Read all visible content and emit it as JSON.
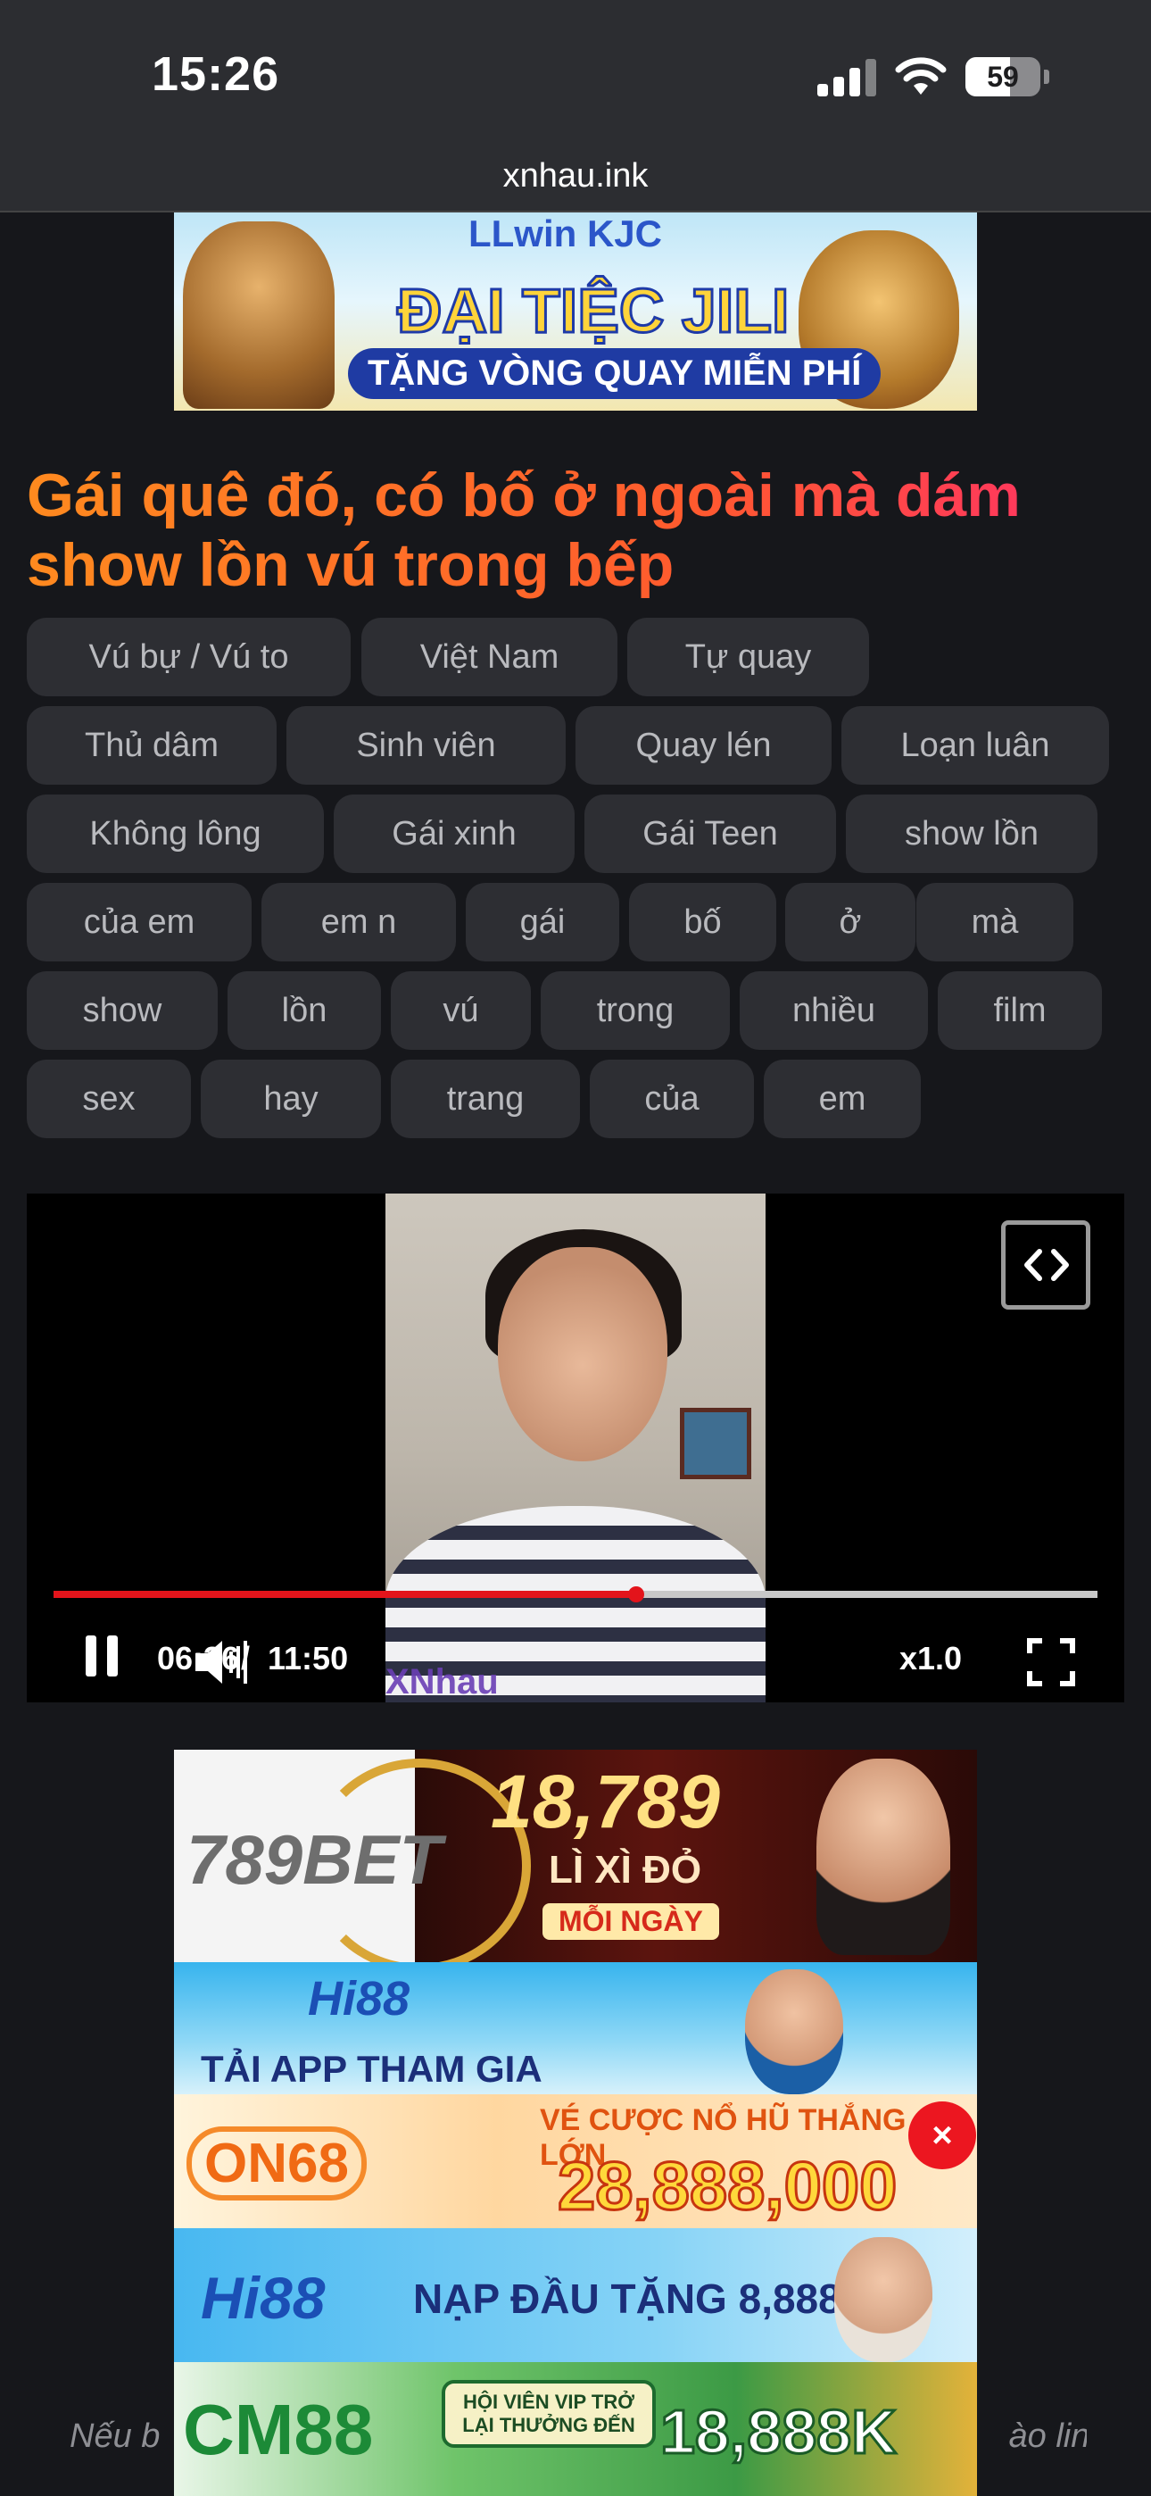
{
  "status_bar": {
    "time": "15:26",
    "battery": "59",
    "battery_level": 0.59
  },
  "browser": {
    "url": "xnhau.ink"
  },
  "top_ad": {
    "brand": "LLwin KJC",
    "headline": "ĐẠI TIỆC JILI",
    "sub": "TẶNG VÒNG QUAY MIỄN PHÍ"
  },
  "page": {
    "title": "Gái quê đó, có bố ở ngoài mà dám show lồn vú trong bếp",
    "tags": [
      "Vú bự / Vú to",
      "Việt Nam",
      "Tự quay",
      "Thủ dâm",
      "Sinh viên",
      "Quay lén",
      "Loạn luân",
      "Không lông",
      "Gái xinh",
      "Gái Teen",
      "show lồn",
      "của em",
      "em n",
      "gái",
      "bố",
      "ở",
      "mà",
      "show",
      "lồn",
      "vú",
      "trong",
      "nhiều",
      "film",
      "sex",
      "hay",
      "trang",
      "của",
      "em"
    ]
  },
  "player": {
    "current_time": "06:36",
    "separator": "/",
    "duration": "11:50",
    "speed": "x1.0",
    "progress": 0.558,
    "watermark": "XNhau",
    "colors": {
      "played": "#e3141b",
      "track": "#c8c8c8"
    }
  },
  "ads": {
    "ad1": {
      "logo": "789BET",
      "amount": "18,789",
      "line": "LÌ XÌ ĐỎ",
      "pill": "MỖI NGÀY"
    },
    "ad2": {
      "logo": "Hi88",
      "text": "TẢI APP THAM GIA"
    },
    "ad3": {
      "logo": "ON68",
      "line": "VÉ CƯỢC NỔ HŨ THẮNG LỚN",
      "amount": "28,888,000"
    },
    "ad4": {
      "logo": "Hi88",
      "text": "NẠP ĐẦU TẶNG 8,888K"
    },
    "ad5": {
      "logo": "CM88",
      "badge": "HỘI VIÊN VIP TRỞ LẠI THƯỞNG ĐẾN",
      "amount": "18,888K"
    },
    "close_label": "×"
  },
  "footer": {
    "note_left": "Nếu b",
    "note_right": "ào link"
  },
  "theme": {
    "background": "#16171b",
    "tag_bg": "#2d2e33",
    "tag_text": "#b9babe",
    "title_gradient": [
      "#ff8a1f",
      "#ff2e6a"
    ]
  }
}
